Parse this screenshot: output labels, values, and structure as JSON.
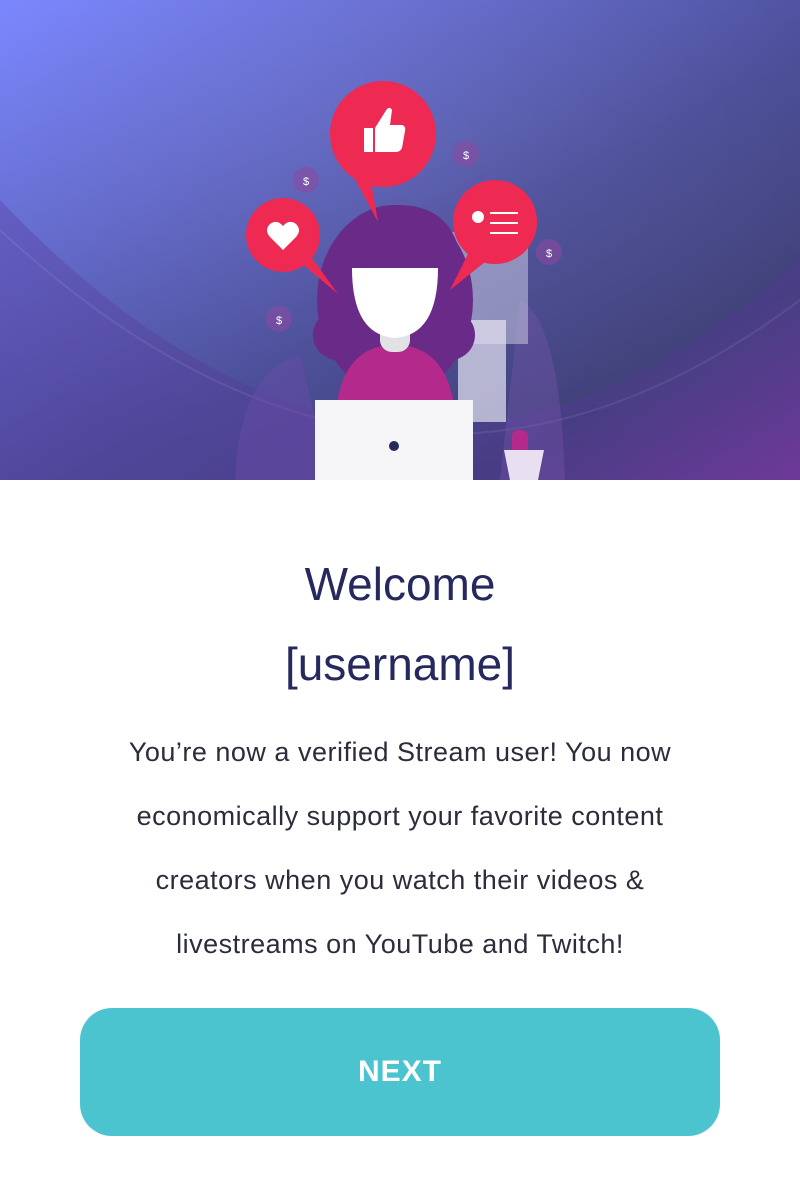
{
  "hero": {
    "illustration": "streamer-illustration",
    "coin_symbol": "$",
    "colors": {
      "bg_start": "#7a86ff",
      "bg_mid": "#4c4f9e",
      "bg_end": "#6e3a90",
      "bubble": "#ee2a52",
      "hair": "#6a2a88",
      "shirt": "#b42a8c"
    }
  },
  "welcome": {
    "title_line1": "Welcome",
    "title_line2": "[username]",
    "message": "You’re now a verified Stream user! You now economically support your favorite content creators when you watch their videos & livestreams on YouTube and Twitch!"
  },
  "actions": {
    "next_label": "NEXT",
    "next_color": "#4bc4d0"
  },
  "colors": {
    "title_text": "#25295e",
    "body_text": "#2b2d3a"
  }
}
